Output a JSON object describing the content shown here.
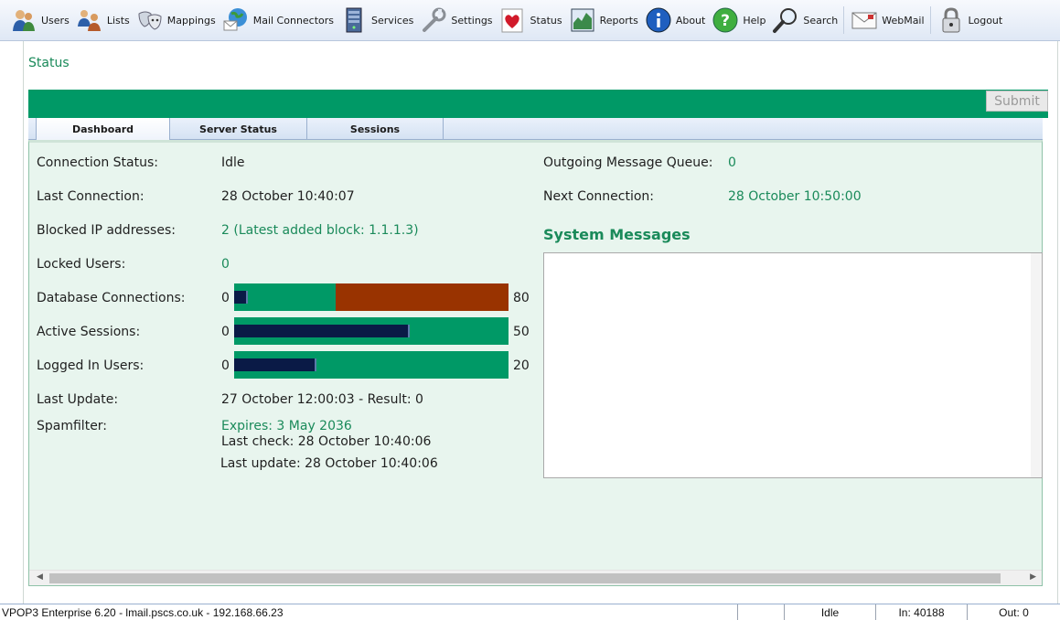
{
  "toolbar": {
    "items": [
      {
        "label": "Users",
        "icon": "users-icon"
      },
      {
        "label": "Lists",
        "icon": "lists-icon"
      },
      {
        "label": "Mappings",
        "icon": "masks-icon"
      },
      {
        "label": "Mail Connectors",
        "icon": "globe-mail-icon"
      },
      {
        "label": "Services",
        "icon": "server-icon"
      },
      {
        "label": "Settings",
        "icon": "wrench-icon"
      },
      {
        "label": "Status",
        "icon": "heart-icon"
      },
      {
        "label": "Reports",
        "icon": "chart-icon"
      },
      {
        "label": "About",
        "icon": "info-icon"
      },
      {
        "label": "Help",
        "icon": "help-icon"
      },
      {
        "label": "Search",
        "icon": "magnifier-icon"
      },
      {
        "label": "WebMail",
        "icon": "envelope-icon"
      },
      {
        "label": "Logout",
        "icon": "padlock-icon"
      }
    ]
  },
  "page": {
    "title": "Status",
    "submit_label": "Submit"
  },
  "tabs": [
    {
      "label": "Dashboard",
      "active": true
    },
    {
      "label": "Server Status",
      "active": false
    },
    {
      "label": "Sessions",
      "active": false
    }
  ],
  "dashboard": {
    "connection_status": {
      "label": "Connection Status:",
      "value": "Idle"
    },
    "last_connection": {
      "label": "Last Connection:",
      "value": "28 October 10:40:07"
    },
    "blocked_ip": {
      "label": "Blocked IP addresses:",
      "value": "2 (Latest added block: 1.1.1.3)"
    },
    "locked_users": {
      "label": "Locked Users:",
      "value": "0"
    },
    "db_connections": {
      "label": "Database Connections:",
      "min": "0",
      "max": "80",
      "fill_fraction": 0.05,
      "red_start_fraction": 0.37
    },
    "active_sessions": {
      "label": "Active Sessions:",
      "min": "0",
      "max": "50",
      "fill_fraction": 0.64
    },
    "logged_in_users": {
      "label": "Logged In Users:",
      "min": "0",
      "max": "20",
      "fill_fraction": 0.3
    },
    "last_update": {
      "label": "Last Update:",
      "value": "27 October 12:00:03 - Result: 0"
    },
    "spamfilter": {
      "label": "Spamfilter:",
      "expires": "Expires: 3 May 2036",
      "last_check": "Last check: 28 October 10:40:06",
      "last_update": "Last update: 28 October 10:40:06"
    },
    "outgoing_queue": {
      "label": "Outgoing Message Queue:",
      "value": "0"
    },
    "next_connection": {
      "label": "Next Connection:",
      "value": "28 October 10:50:00"
    },
    "system_messages_title": "System Messages"
  },
  "statusbar": {
    "info": "VPOP3 Enterprise 6.20 - lmail.pscs.co.uk - 192.168.66.23",
    "state": "Idle",
    "in": "In: 40188",
    "out": "Out: 0"
  },
  "colors": {
    "accent_green": "#009966",
    "text_green": "#1a8a5a",
    "bar_red": "#993300",
    "bar_fill": "#0a1a46",
    "content_bg": "#e8f5ee"
  }
}
